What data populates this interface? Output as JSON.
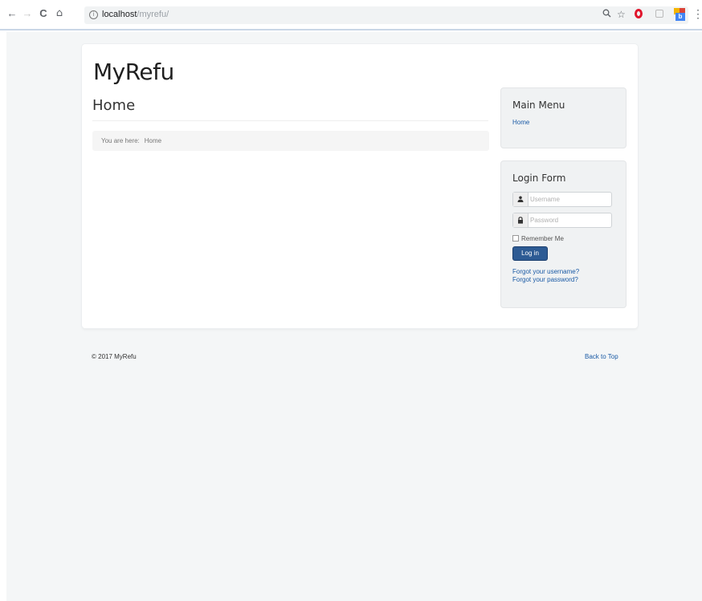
{
  "browser": {
    "back_icon": "←",
    "forward_icon": "→",
    "reload_icon": "C",
    "home_icon": "⌂",
    "info_icon": "i",
    "url_host": "localhost",
    "url_path": "/myrefu/",
    "zoom_icon": "🔍",
    "star_icon": "☆",
    "menu_icon": "⋮",
    "extension_badge": "b"
  },
  "site": {
    "brand": "MyRefu",
    "page_title": "Home",
    "breadcrumb": {
      "prefix": "You are here:",
      "current": "Home"
    }
  },
  "main_menu": {
    "title": "Main Menu",
    "items": [
      {
        "label": "Home"
      }
    ]
  },
  "login_form": {
    "title": "Login Form",
    "username_icon": "👤",
    "password_icon": "🔒",
    "username_placeholder": "Username",
    "password_placeholder": "Password",
    "remember_label": "Remember Me",
    "login_button": "Log in",
    "forgot_username": "Forgot your username?",
    "forgot_password": "Forgot your password?"
  },
  "footer": {
    "copyright": "© 2017 MyRefu",
    "back_to_top": "Back to Top"
  },
  "colors": {
    "link": "#1a5aa5",
    "button": "#2d5b94",
    "page_bg": "#f4f6f7"
  }
}
